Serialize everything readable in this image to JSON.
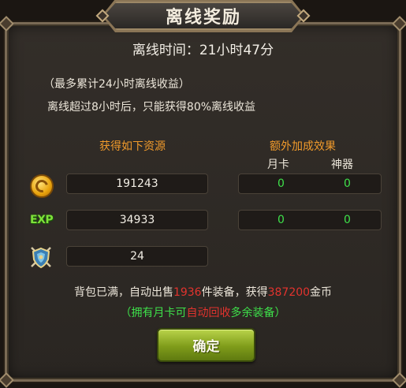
{
  "dialog": {
    "title": "离线奖励",
    "offline_time": "离线时间：21小时47分",
    "note_max": "（最多累计24小时离线收益）",
    "note_limit": "离线超过8小时后，只能获得80%离线收益"
  },
  "resources": {
    "header": "获得如下资源",
    "rows": [
      {
        "icon": "gold-coin-icon",
        "value": "191243"
      },
      {
        "icon": "exp-icon",
        "label": "EXP",
        "value": "34933"
      },
      {
        "icon": "equipment-shield-icon",
        "value": "24"
      }
    ]
  },
  "bonus": {
    "header": "额外加成效果",
    "col_month_card": "月卡",
    "col_artifact": "神器",
    "rows": [
      {
        "month_card": "0",
        "artifact": "0"
      },
      {
        "month_card": "0",
        "artifact": "0"
      }
    ]
  },
  "footer": {
    "bag_full_prefix": "背包已满，自动出售",
    "sold_count": "1936",
    "bag_full_mid": "件装备，获得",
    "gold_gained": "387200",
    "bag_full_suffix": "金币",
    "hint_prefix": "（拥有月卡可",
    "hint_highlight": "自动回收",
    "hint_suffix": "多余装备）"
  },
  "buttons": {
    "confirm": "确定"
  },
  "colors": {
    "accent_orange": "#f09a2b",
    "bonus_green": "#3ee04a",
    "highlight_red": "#e2332e"
  }
}
